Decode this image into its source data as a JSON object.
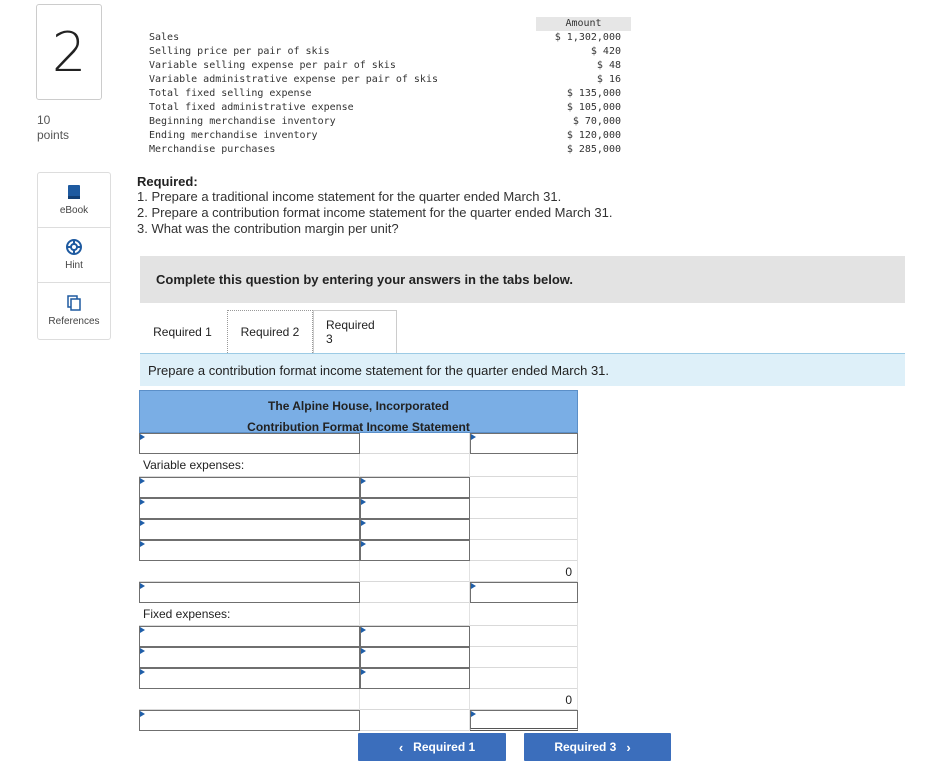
{
  "question": {
    "number": "2",
    "points_value": "10",
    "points_label": "points"
  },
  "tools": [
    {
      "label": "eBook",
      "icon": "book-icon"
    },
    {
      "label": "Hint",
      "icon": "lifebuoy-icon"
    },
    {
      "label": "References",
      "icon": "copy-icon"
    }
  ],
  "data_table": {
    "header": "Amount",
    "rows": [
      {
        "label": "Sales",
        "amount": "$ 1,302,000"
      },
      {
        "label": "Selling price per pair of skis",
        "amount": "$ 420"
      },
      {
        "label": "Variable selling expense per pair of skis",
        "amount": "$ 48"
      },
      {
        "label": "Variable administrative expense per pair of skis",
        "amount": "$ 16"
      },
      {
        "label": "Total fixed selling expense",
        "amount": "$ 135,000"
      },
      {
        "label": "Total fixed administrative expense",
        "amount": "$ 105,000"
      },
      {
        "label": "Beginning merchandise inventory",
        "amount": "$ 70,000"
      },
      {
        "label": "Ending merchandise inventory",
        "amount": "$ 120,000"
      },
      {
        "label": "Merchandise purchases",
        "amount": "$ 285,000"
      }
    ]
  },
  "required": {
    "title": "Required:",
    "items": [
      "1. Prepare a traditional income statement for the quarter ended March 31.",
      "2. Prepare a contribution format income statement for the quarter ended March 31.",
      "3. What was the contribution margin per unit?"
    ]
  },
  "complete_bar": "Complete this question by entering your answers in the tabs below.",
  "tabs": [
    "Required 1",
    "Required 2",
    "Required 3"
  ],
  "instruction": "Prepare a contribution format income statement for the quarter ended March 31.",
  "statement": {
    "company": "The Alpine House, Incorporated",
    "title": "Contribution Format Income Statement",
    "variable_label": "Variable expenses:",
    "fixed_label": "Fixed expenses:",
    "variable_total": "0",
    "fixed_total": "0"
  },
  "nav": {
    "prev": "Required 1",
    "next": "Required 3"
  },
  "colors": {
    "accent": "#3b6ebc",
    "header": "#7aaee5",
    "instruction_bg": "#def0f9"
  }
}
